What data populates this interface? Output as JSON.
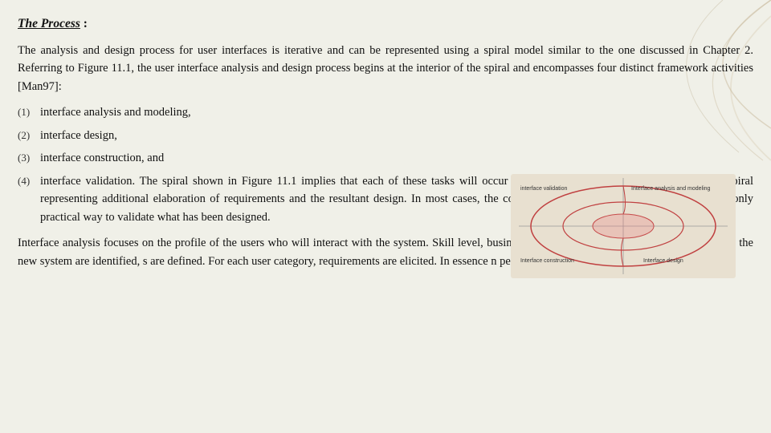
{
  "title": {
    "underlined": "The Process",
    "colon": " :"
  },
  "para1": "The analysis and design process for user interfaces is iterative and can be represented using a spiral model similar to the one discussed in Chapter 2. Referring to Figure 11.1, the user interface analysis and design process begins at the interior of the spiral and encompasses four distinct framework activities [Man97]:",
  "list": [
    {
      "num": "(1)",
      "text": "interface analysis and modeling,"
    },
    {
      "num": "(2)",
      "text": "interface design,"
    },
    {
      "num": "(3)",
      "text": "interface construction, and"
    },
    {
      "num": "(4)",
      "text": "interface validation. The spiral shown in Figure 11.1 implies that each of these tasks will occur more than once, with each pass around the spiral representing additional elaboration of requirements and the resultant design. In most cases, the construction activity involves prototyping—the only practical way to validate what has been designed."
    }
  ],
  "para2": "Interface analysis focuses on the profile of the users who will interact with the system. Skill level, business understanding, and general receptiveness to the new system are          identified,           s are defined. For each user category, requirements are elicited. In essence                                          n perception (Section 11.2.1) for each class of users.",
  "diagram": {
    "labels": {
      "topLeft": "interface validation",
      "topRight": "Interface analysis and modeling",
      "bottomLeft": "Interface construction",
      "bottomRight": "Interface design"
    }
  }
}
